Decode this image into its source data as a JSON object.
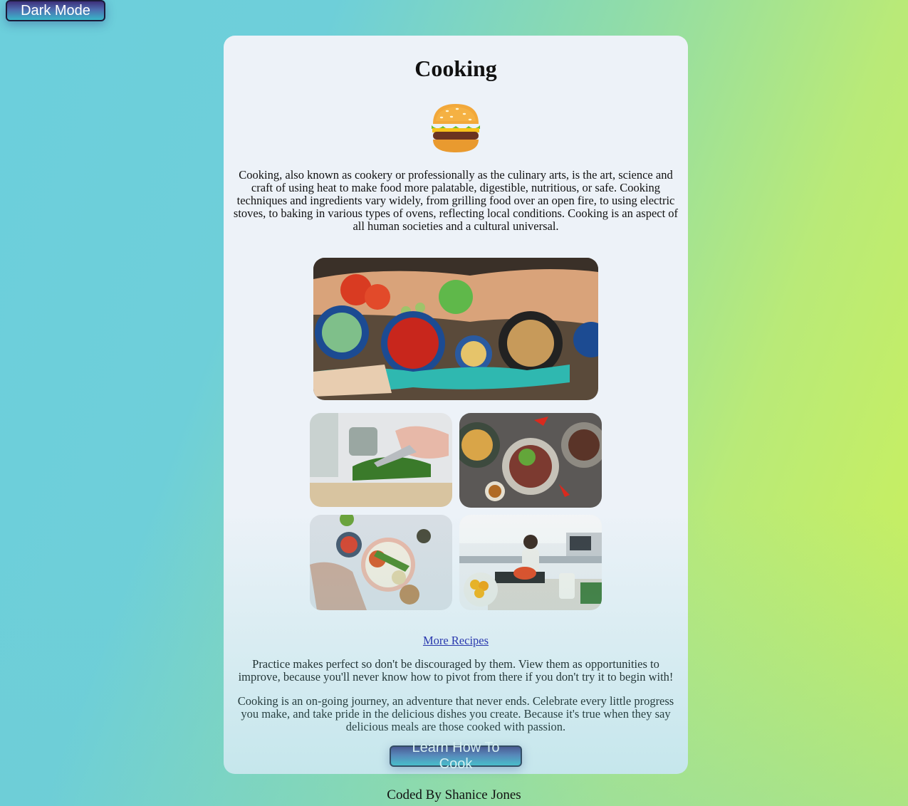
{
  "header": {
    "toggle_label": "Dark Mode"
  },
  "card": {
    "title": "Cooking",
    "intro": "Cooking, also known as cookery or professionally as the culinary arts, is the art, science and craft of using heat to make food more palatable, digestible, nutritious, or safe. Cooking techniques and ingredients vary widely, from grilling food over an open fire, to using electric stoves, to baking in various types of ovens, reflecting local conditions. Cooking is an aspect of all human societies and a cultural universal.",
    "more_link": "More Recipes",
    "para1": "Practice makes perfect so don't be discouraged by them. View them as opportunities to improve, because you'll never know how to pivot from there if you don't try it to begin with!",
    "para2": "Cooking is an on-going journey, an adventure that never ends. Celebrate every little progress you make, and take pride in the delicious dishes you create. Because it's true when they say delicious meals are those cooked with passion.",
    "cta_label": "Learn How To Cook"
  },
  "footer": {
    "credit": "Coded By Shanice Jones"
  },
  "icons": {
    "hero_icon": "burger-icon"
  },
  "colors": {
    "card_bg": "#edf2f8",
    "link": "#1a1aa6",
    "button_top": "#3d2f7a",
    "button_bottom": "#38b7c8"
  }
}
